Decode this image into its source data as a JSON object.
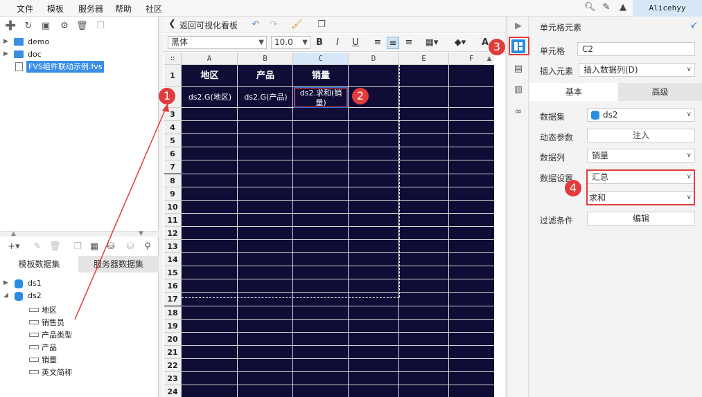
{
  "menu": {
    "items": [
      "文件",
      "模板",
      "服务器",
      "帮助",
      "社区"
    ],
    "user": "Alicehyy"
  },
  "file_tree": [
    {
      "label": "demo",
      "type": "folder"
    },
    {
      "label": "doc",
      "type": "folder"
    },
    {
      "label": "FVS组件联动示例.fvs",
      "type": "file"
    }
  ],
  "dataset_tabs": [
    "模板数据集",
    "服务器数据集"
  ],
  "datasets": [
    {
      "label": "ds1"
    },
    {
      "label": "ds2",
      "fields": [
        "地区",
        "销售员",
        "产品类型",
        "产品",
        "销量",
        "英文简称"
      ]
    }
  ],
  "toolbar": {
    "back_label": "返回可视化看板",
    "font": "黑体",
    "font_size": "10.0"
  },
  "grid": {
    "columns": [
      "A",
      "B",
      "C",
      "D",
      "E",
      "F"
    ],
    "rows": [
      "1",
      "2",
      "3",
      "4",
      "5",
      "6",
      "7",
      "8",
      "9",
      "10",
      "11",
      "12",
      "13",
      "14",
      "15",
      "16",
      "17",
      "18",
      "19",
      "20",
      "21",
      "22",
      "23",
      "24"
    ],
    "header_cells": [
      "地区",
      "产品",
      "销量"
    ],
    "data_cells": [
      "ds2.G(地区)",
      "ds2.G(产品)",
      "ds2.求和(销量)"
    ]
  },
  "panel": {
    "title": "单元格元素",
    "cell_label": "单元格",
    "cell_value": "C2",
    "insert_label": "插入元素",
    "insert_value": "插入数据列(D)",
    "tabs": [
      "基本",
      "高级"
    ],
    "dataset_label": "数据集",
    "dataset_value": "ds2",
    "param_label": "动态参数",
    "param_button": "注入",
    "column_label": "数据列",
    "column_value": "销量",
    "setting_label": "数据设置",
    "setting_value1": "汇总",
    "setting_value2": "求和",
    "filter_label": "过滤条件",
    "filter_button": "编辑"
  },
  "badges": [
    "1",
    "2",
    "3",
    "4"
  ],
  "colors": {
    "grid_bg": "#0f0d36",
    "accent": "#2a8de0",
    "badge": "#e23b3b"
  }
}
